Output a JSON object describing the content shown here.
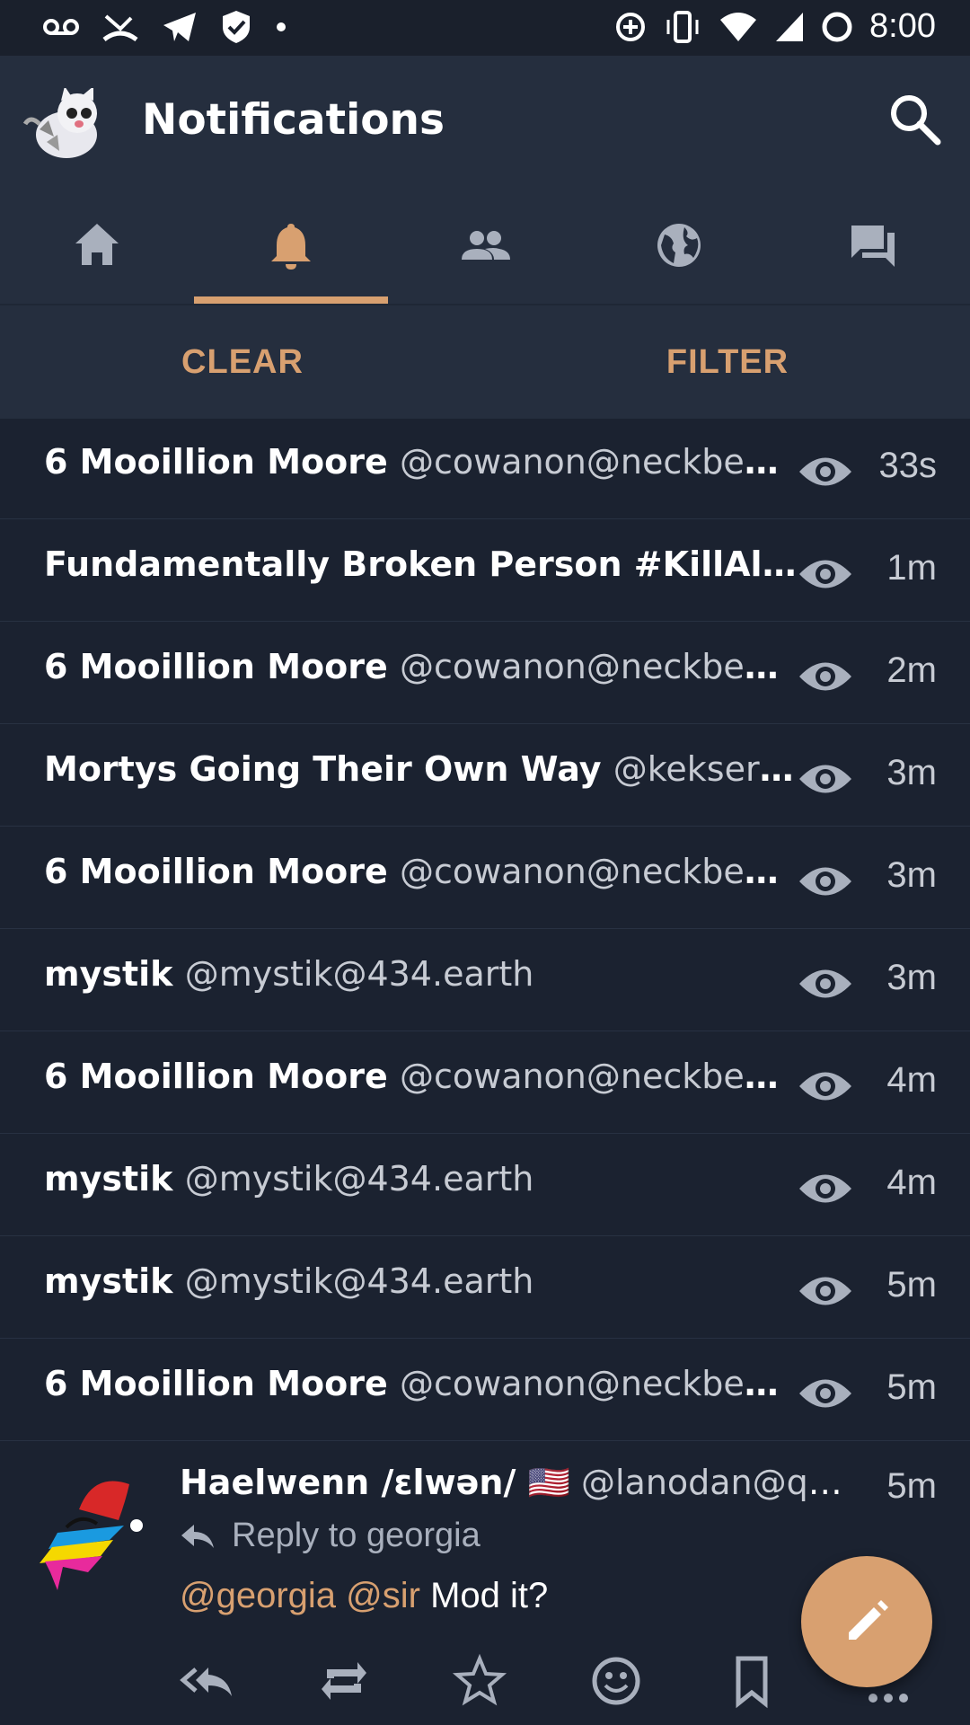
{
  "status_bar": {
    "time": "8:00",
    "left_icons": [
      "voicemail-icon",
      "missed-call-icon",
      "telegram-icon",
      "shield-check-icon",
      "dot-icon"
    ],
    "right_icons": [
      "data-saver-icon",
      "vibrate-icon",
      "wifi-icon",
      "signal-icon",
      "battery-icon"
    ]
  },
  "app_bar": {
    "title": "Notifications",
    "search_icon": "search-icon"
  },
  "tabs": [
    {
      "icon": "home-icon",
      "active": false
    },
    {
      "icon": "bell-icon",
      "active": true
    },
    {
      "icon": "people-icon",
      "active": false
    },
    {
      "icon": "globe-icon",
      "active": false
    },
    {
      "icon": "chat-icon",
      "active": false
    }
  ],
  "actions": {
    "clear_label": "CLEAR",
    "filter_label": "FILTER"
  },
  "notifications": [
    {
      "name": "6 Mooillion Moore",
      "handle": "@cowanon@neckbear…",
      "time": "33s"
    },
    {
      "name": "Fundamentally Broken Person #KillAll…",
      "handle": "",
      "time": "1m"
    },
    {
      "name": "6 Mooillion Moore",
      "handle": "@cowanon@neckbear…",
      "time": "2m"
    },
    {
      "name": "Mortys Going Their Own Way",
      "handle": "@kekserva…",
      "time": "3m"
    },
    {
      "name": "6 Mooillion Moore",
      "handle": "@cowanon@neckbear…",
      "time": "3m"
    },
    {
      "name": "mystik",
      "handle": "@mystik@434.earth",
      "time": "3m"
    },
    {
      "name": "6 Mooillion Moore",
      "handle": "@cowanon@neckbear…",
      "time": "4m"
    },
    {
      "name": "mystik",
      "handle": "@mystik@434.earth",
      "time": "4m"
    },
    {
      "name": "mystik",
      "handle": "@mystik@434.earth",
      "time": "5m"
    },
    {
      "name": "6 Mooillion Moore",
      "handle": "@cowanon@neckbear…",
      "time": "5m"
    }
  ],
  "status": {
    "name": "Haelwenn /ɛlwən/ 🇺🇸",
    "handle": "@lanodan@qu…",
    "time": "5m",
    "reply_to": "Reply to georgia",
    "mention_1": "@georgia",
    "mention_2": "@sir",
    "text": "Mod it?"
  },
  "colors": {
    "accent": "#d8a070",
    "background": "#1b2230",
    "surface": "#252e3e"
  }
}
